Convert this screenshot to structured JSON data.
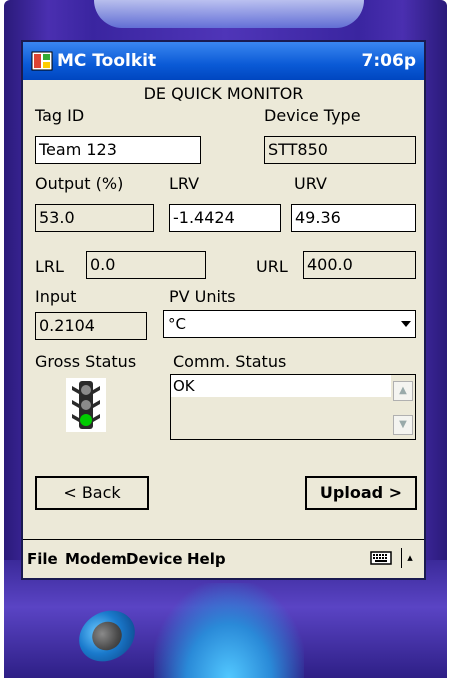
{
  "titlebar": {
    "app_name": "MC Toolkit",
    "time": "7:06p"
  },
  "screen_title": "DE QUICK MONITOR",
  "fields": {
    "tag_id": {
      "label": "Tag ID",
      "value": "Team 123"
    },
    "device_type": {
      "label": "Device Type",
      "value": "STT850"
    },
    "output": {
      "label": "Output (%)",
      "value": "53.0"
    },
    "lrv": {
      "label": "LRV",
      "value": "-1.4424"
    },
    "urv": {
      "label": "URV",
      "value": "49.36"
    },
    "lrl": {
      "label": "LRL",
      "value": "0.0"
    },
    "url": {
      "label": "URL",
      "value": "400.0"
    },
    "input": {
      "label": "Input",
      "value": "0.2104"
    },
    "pv_units": {
      "label": "PV Units",
      "value": "°C"
    }
  },
  "gross_status": {
    "label": "Gross Status",
    "icon": "traffic-light-green-icon"
  },
  "comm_status": {
    "label": "Comm. Status",
    "value": "OK"
  },
  "buttons": {
    "back": "< Back",
    "upload": "Upload >"
  },
  "menubar": {
    "items": [
      "File",
      "Modem",
      "Device",
      "Help"
    ],
    "keyboard_icon": "keyboard-icon",
    "up_arrow": "▴"
  },
  "colors": {
    "titlebar": "#0a5ad6",
    "screen_bg": "#ece9d8",
    "device_body": "#4a2fb0",
    "status_green": "#00cc00"
  }
}
